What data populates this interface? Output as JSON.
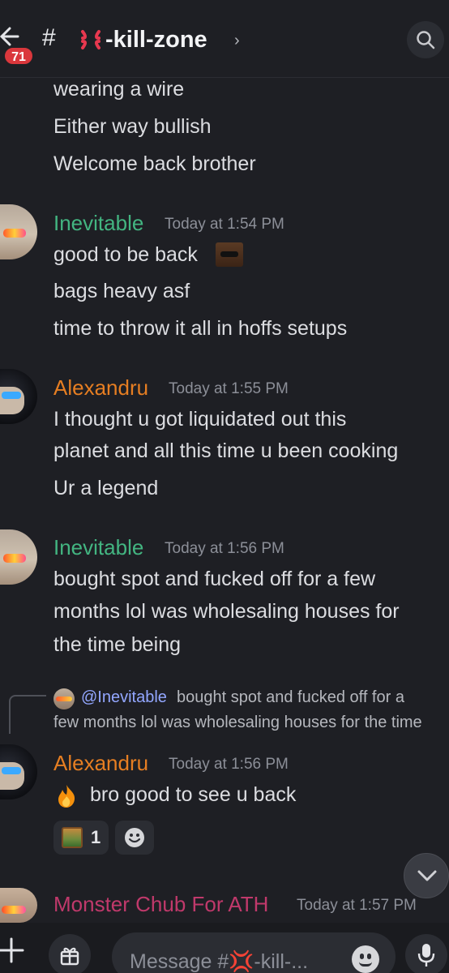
{
  "header": {
    "badge_count": "71",
    "hash": "#",
    "channel_name": "-kill-zone",
    "chevron": "›"
  },
  "messages": {
    "top_lines": [
      "wearing a wire",
      "Either way bullish",
      "Welcome back brother"
    ],
    "m1": {
      "author": "Inevitable",
      "author_color": "#43b581",
      "timestamp": "Today at 1:54 PM",
      "lines": [
        "good to be back",
        "bags heavy asf",
        "time to throw it all in hoffs setups"
      ]
    },
    "m2": {
      "author": "Alexandru",
      "author_color": "#e67e22",
      "timestamp": "Today at 1:55 PM",
      "lines": [
        "I thought u got liquidated out this",
        "planet and all this time u been cooking",
        "Ur a legend"
      ]
    },
    "m3": {
      "author": "Inevitable",
      "author_color": "#43b581",
      "timestamp": "Today at 1:56 PM",
      "lines": [
        "bought spot and fucked off for a few",
        "months lol was wholesaling houses for",
        "the time being"
      ]
    },
    "m4": {
      "reply_mention": "@Inevitable",
      "reply_text_1": "bought spot and fucked off for a",
      "reply_text_2": "few months lol was wholesaling houses for the time",
      "author": "Alexandru",
      "author_color": "#e67e22",
      "timestamp": "Today at 1:56 PM",
      "line": "bro good to see u back",
      "reaction_count": "1"
    },
    "m5": {
      "author": "Monster Chub For ATH",
      "author_color": "#c0396b",
      "timestamp": "Today at 1:57 PM"
    }
  },
  "composer": {
    "placeholder": "Message #💢-kill-..."
  },
  "icons": [
    "back-arrow-icon",
    "anger-emoji-icon",
    "search-icon",
    "sunglasses-emoji-icon",
    "fire-emoji-icon",
    "add-reaction-icon",
    "chevron-down-icon",
    "plus-icon",
    "gift-icon",
    "emoji-icon",
    "mic-icon"
  ]
}
